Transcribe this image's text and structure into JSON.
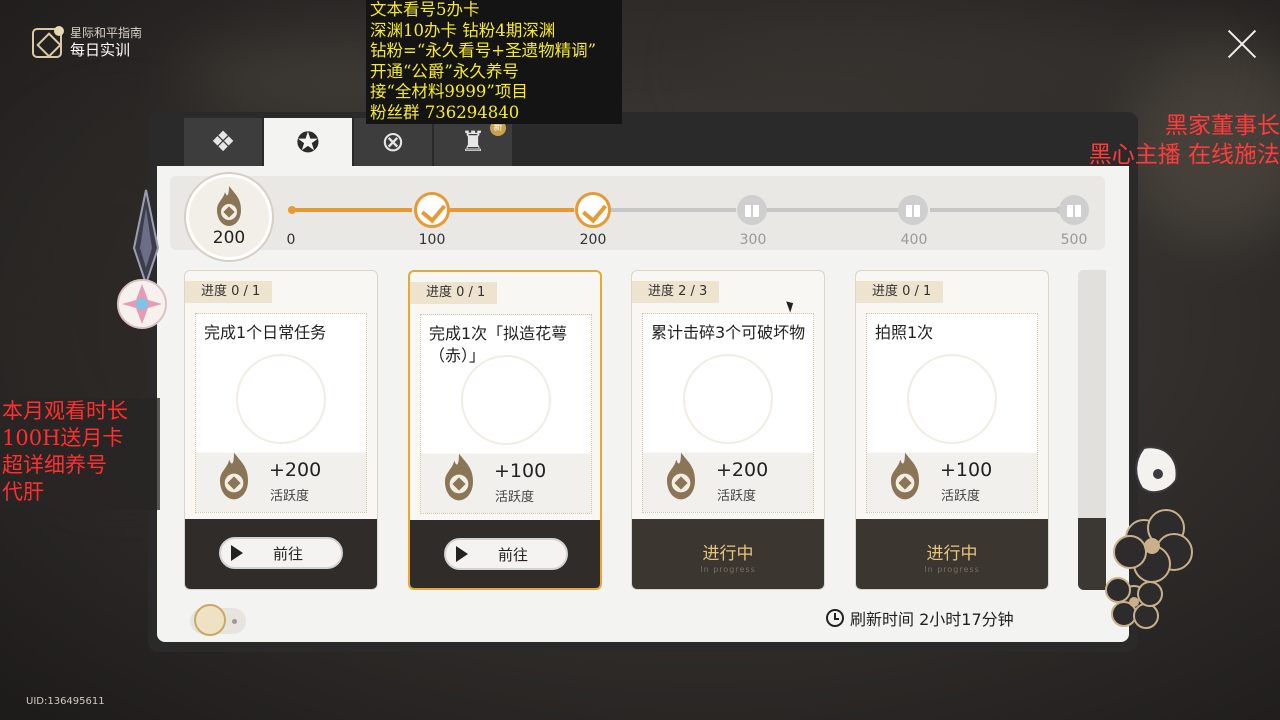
{
  "header": {
    "subtitle": "星际和平指南",
    "title": "每日实训"
  },
  "overlay": {
    "top_lines": [
      "文本看号5办卡",
      "深渊10办卡 钻粉4期深渊",
      "钻粉=“永久看号+圣遗物精调”",
      "开通“公爵”永久养号",
      "接“全材料9999”项目",
      "粉丝群 736294840"
    ],
    "right_lines": [
      "黑家董事长",
      "黑心主播 在线施法"
    ],
    "left_lines": [
      "本月观看时长",
      "100H送月卡",
      "超详细养号",
      "代肝"
    ]
  },
  "tabs": [
    {
      "icon": "daily-training-tab-icon",
      "active": false
    },
    {
      "icon": "activity-tab-icon",
      "active": true
    },
    {
      "icon": "ability-tab-icon",
      "active": false
    },
    {
      "icon": "strength-tab-icon",
      "active": false,
      "new_badge": "新"
    }
  ],
  "progress": {
    "current_points": "200",
    "milestones": [
      {
        "label": "0"
      },
      {
        "label": "100",
        "claimed": true
      },
      {
        "label": "200",
        "claimed": true
      },
      {
        "label": "300",
        "claimed": false
      },
      {
        "label": "400",
        "claimed": false
      },
      {
        "label": "500",
        "claimed": false
      }
    ]
  },
  "cards": [
    {
      "progress": "进度   0 / 1",
      "title": "完成1个日常任务",
      "reward": "+200",
      "reward_label": "活跃度",
      "action": "前往",
      "state": "go"
    },
    {
      "progress": "进度   0 / 1",
      "title": "完成1次「拟造花萼（赤）」",
      "reward": "+100",
      "reward_label": "活跃度",
      "action": "前往",
      "state": "go"
    },
    {
      "progress": "进度   2 / 3",
      "title": "累计击碎3个可破坏物",
      "reward": "+200",
      "reward_label": "活跃度",
      "action": "进行中",
      "action_sub": "In progress",
      "state": "inprogress"
    },
    {
      "progress": "进度   0 / 1",
      "title": "拍照1次",
      "reward": "+100",
      "reward_label": "活跃度",
      "action": "进行中",
      "action_sub": "In progress",
      "state": "inprogress"
    }
  ],
  "refresh_text": "刷新时间 2小时17分钟",
  "uid": "UID:136495611",
  "colors": {
    "accent": "#e69a36",
    "card_footer": "#2f2c29",
    "in_progress_text": "#e8c57c"
  }
}
